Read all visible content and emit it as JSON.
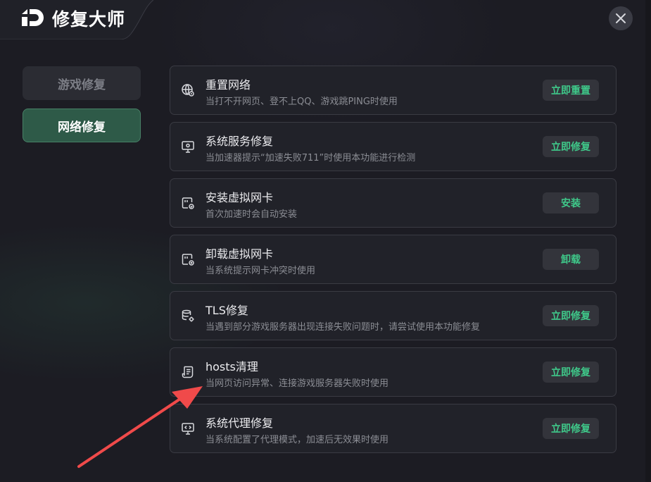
{
  "app": {
    "title": "修复大师",
    "close_icon": "close-icon",
    "logo_icon": "app-logo-icon"
  },
  "sidebar": {
    "items": [
      {
        "label": "游戏修复",
        "active": false
      },
      {
        "label": "网络修复",
        "active": true
      }
    ]
  },
  "repairs": [
    {
      "icon": "globe-icon",
      "title": "重置网络",
      "desc": "当打不开网页、登不上QQ、游戏跳PING时使用",
      "button": "立即重置"
    },
    {
      "icon": "monitor-service-icon",
      "title": "系统服务修复",
      "desc": "当加速器提示“加速失败711”时使用本功能进行检测",
      "button": "立即修复"
    },
    {
      "icon": "network-card-install-icon",
      "title": "安装虚拟网卡",
      "desc": "首次加速时会自动安装",
      "button": "安装"
    },
    {
      "icon": "network-card-uninstall-icon",
      "title": "卸载虚拟网卡",
      "desc": "当系统提示网卡冲突时使用",
      "button": "卸载"
    },
    {
      "icon": "database-gear-icon",
      "title": "TLS修复",
      "desc": "当遇到部分游戏服务器出现连接失败问题时，请尝试使用本功能修复",
      "button": "立即修复"
    },
    {
      "icon": "document-list-icon",
      "title": "hosts清理",
      "desc": "当网页访问异常、连接游戏服务器失败时使用",
      "button": "立即修复"
    },
    {
      "icon": "monitor-proxy-icon",
      "title": "系统代理修复",
      "desc": "当系统配置了代理模式，加速后无效果时使用",
      "button": "立即修复"
    }
  ],
  "colors": {
    "accent": "#3fc98a",
    "annotation_arrow": "#f04a4a"
  }
}
